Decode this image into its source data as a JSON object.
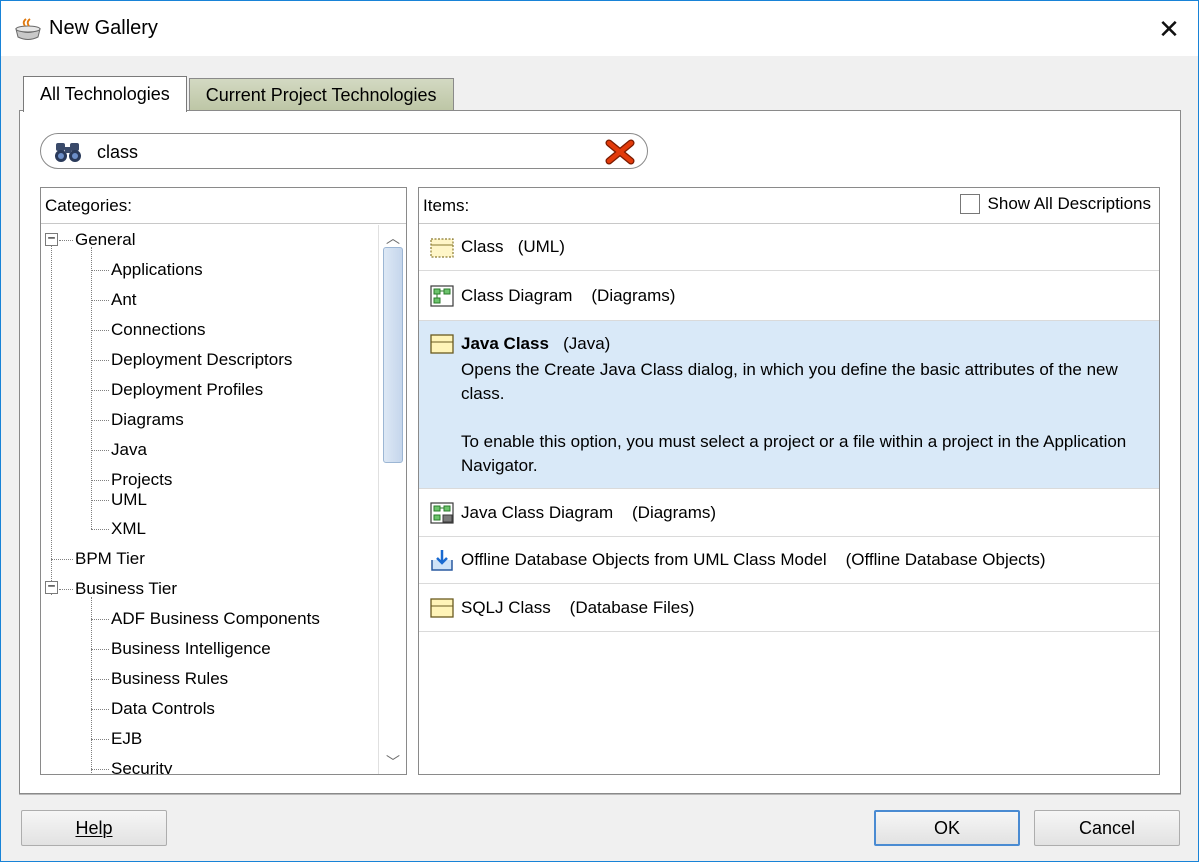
{
  "window": {
    "title": "New Gallery",
    "close_glyph": "✕"
  },
  "tabs": [
    {
      "label": "All Technologies",
      "active": true
    },
    {
      "label": "Current Project Technologies",
      "active": false
    }
  ],
  "search": {
    "value": "class",
    "placeholder": ""
  },
  "categories": {
    "header": "Categories:",
    "groups": [
      {
        "label": "General",
        "expanded": true,
        "children": [
          "Applications",
          "Ant",
          "Connections",
          "Deployment Descriptors",
          "Deployment Profiles",
          "Diagrams",
          "Java",
          "Projects",
          "UML",
          "XML"
        ]
      },
      {
        "label": "BPM Tier",
        "expanded": false,
        "children": []
      },
      {
        "label": "Business Tier",
        "expanded": true,
        "children": [
          "ADF Business Components",
          "Business Intelligence",
          "Business Rules",
          "Data Controls",
          "EJB",
          "Security"
        ]
      }
    ]
  },
  "items": {
    "header": "Items:",
    "show_all_label": "Show All Descriptions",
    "list": [
      {
        "name": "Class",
        "category": "(UML)",
        "icon": "uml-class-icon"
      },
      {
        "name": "Class Diagram",
        "category": "(Diagrams)",
        "icon": "class-diagram-icon"
      },
      {
        "name": "Java Class",
        "category": "(Java)",
        "icon": "java-class-icon",
        "selected": true,
        "description_1": "Opens the Create Java Class dialog, in which you define the basic attributes of the new class.",
        "description_2": "To enable this option, you must select a project or a file within a project in the Application Navigator."
      },
      {
        "name": "Java Class Diagram",
        "category": "(Diagrams)",
        "icon": "java-class-diagram-icon"
      },
      {
        "name": "Offline Database Objects from UML Class Model",
        "category": "(Offline Database Objects)",
        "icon": "offline-db-icon"
      },
      {
        "name": "SQLJ Class",
        "category": "(Database Files)",
        "icon": "sqlj-class-icon"
      }
    ]
  },
  "buttons": {
    "help": "Help",
    "ok": "OK",
    "cancel": "Cancel"
  }
}
